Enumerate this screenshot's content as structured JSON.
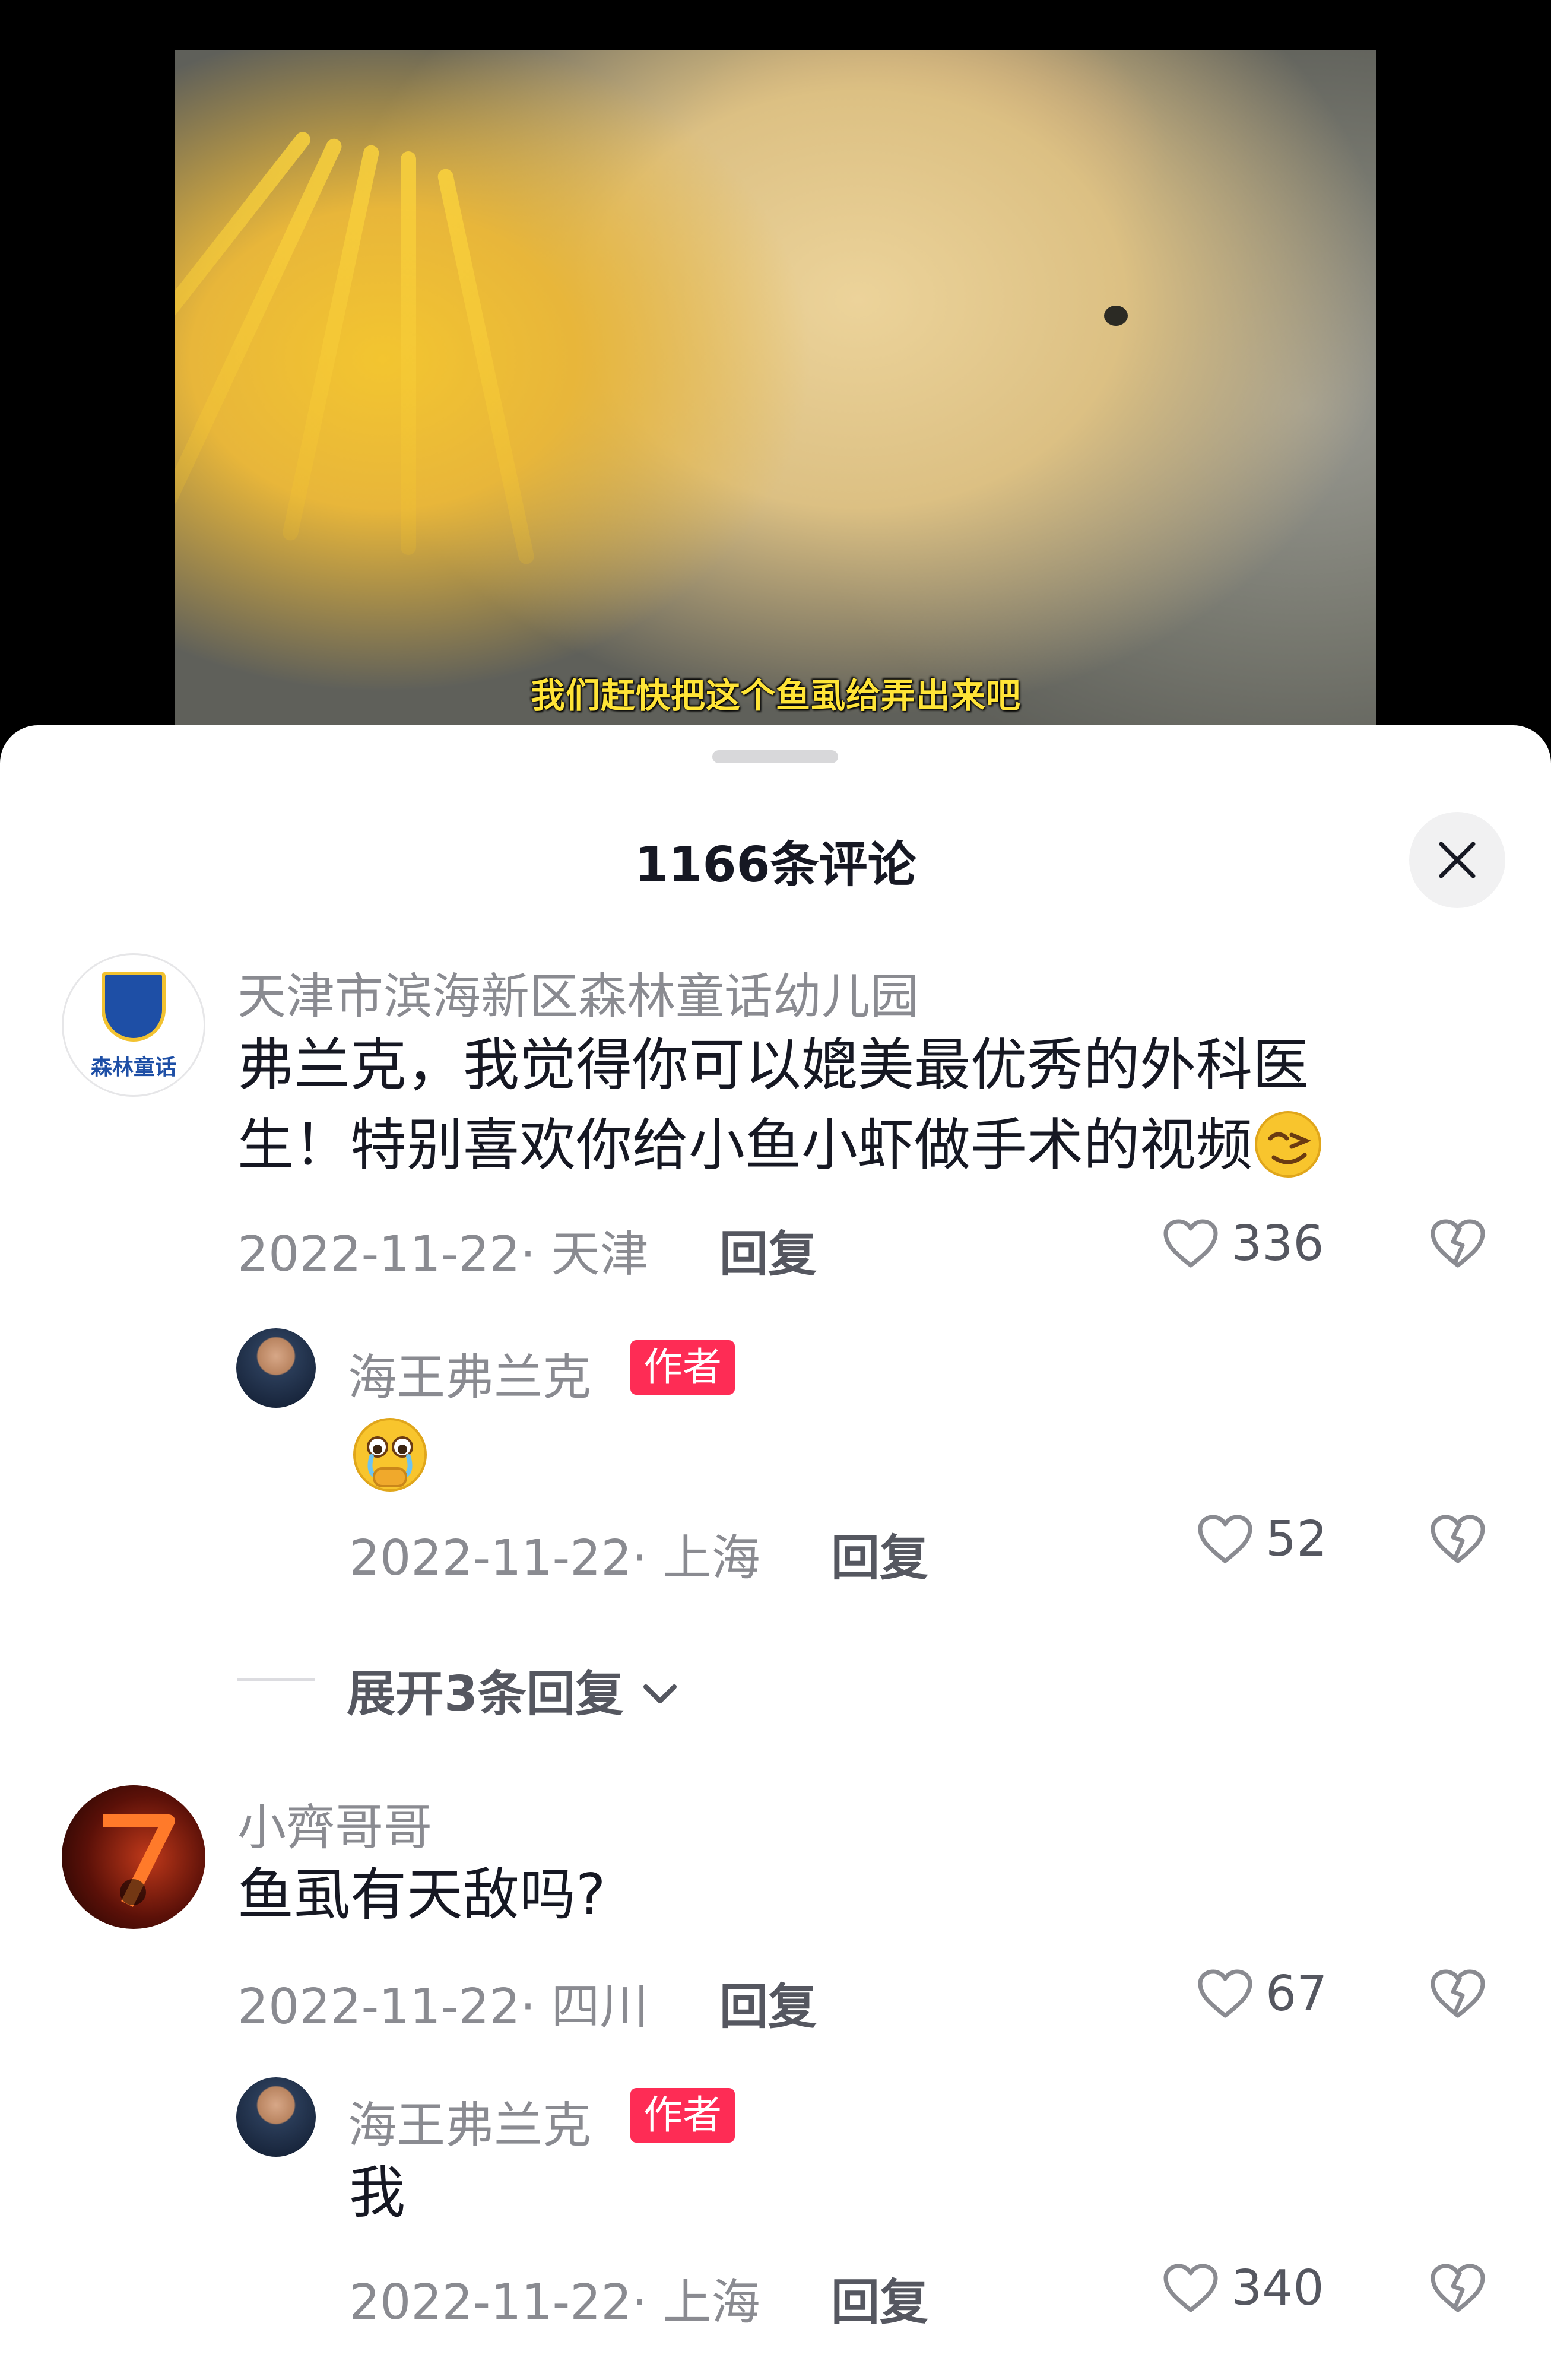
{
  "video": {
    "subtitle": "我们赶快把这个鱼虱给弄出来吧"
  },
  "comments_header": {
    "title": "1166条评论",
    "close_icon": "close-icon"
  },
  "comments": [
    {
      "author": "天津市滨海新区森林童话幼儿园",
      "avatar_text": "森林童话",
      "text": "弗兰克，我觉得你可以媲美最优秀的外科医生！特别喜欢你给小鱼小虾做手术的视频",
      "emoji": "smirk-face",
      "date_location": "2022-11-22· 天津",
      "reply_label": "回复",
      "likes": "336",
      "reply": {
        "author": "海王弗兰克",
        "badge": "作者",
        "emoji": "crying-face",
        "date_location": "2022-11-22· 上海",
        "reply_label": "回复",
        "likes": "52"
      },
      "expand_label": "展开3条回复"
    },
    {
      "author": "小齊哥哥",
      "text": "鱼虱有天敌吗?",
      "date_location": "2022-11-22· 四川",
      "reply_label": "回复",
      "likes": "67",
      "reply": {
        "author": "海王弗兰克",
        "badge": "作者",
        "text": "我",
        "date_location": "2022-11-22· 上海",
        "reply_label": "回复",
        "likes": "340"
      }
    }
  ],
  "colors": {
    "accent": "#fe2c55",
    "text_primary": "#161823",
    "text_secondary": "#8a8b91",
    "subtitle": "#ffe437"
  }
}
